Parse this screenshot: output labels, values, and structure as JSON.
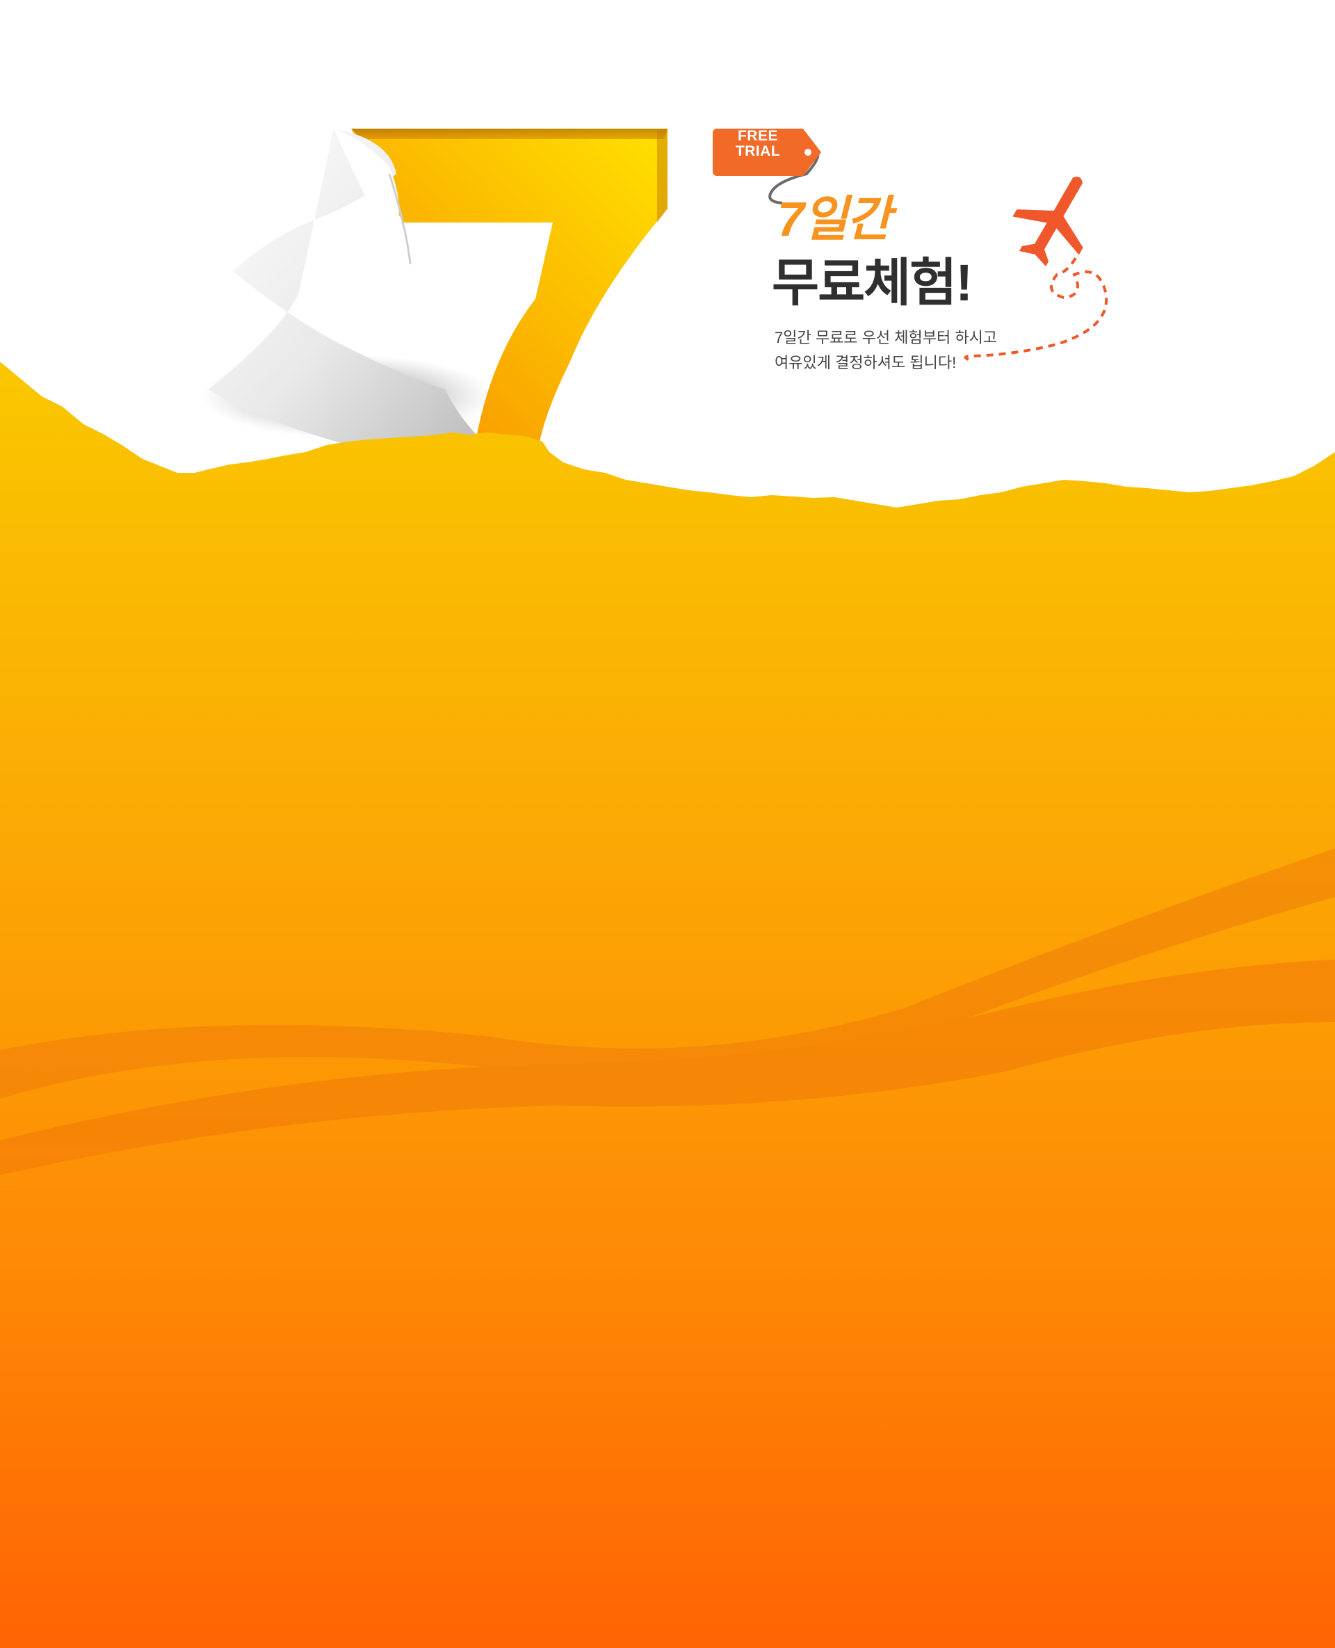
{
  "tag": {
    "line1": "FREE",
    "line2": "TRIAL"
  },
  "headline": {
    "days": "7일간",
    "main": "무료체험!"
  },
  "description": {
    "line1": "7일간 무료로 우선 체험부터 하시고",
    "line2": "여유있게 결정하셔도 됩니다!"
  },
  "decor": {
    "big_number": "7",
    "icons": [
      "airplane-icon",
      "dashed-flight-path",
      "price-tag-icon",
      "paper-curl"
    ]
  },
  "colors": {
    "orange_top": "#f9c200",
    "orange_bottom": "#ff6204",
    "accent": "#f26a28",
    "heading_dark": "#2f2f2f"
  }
}
